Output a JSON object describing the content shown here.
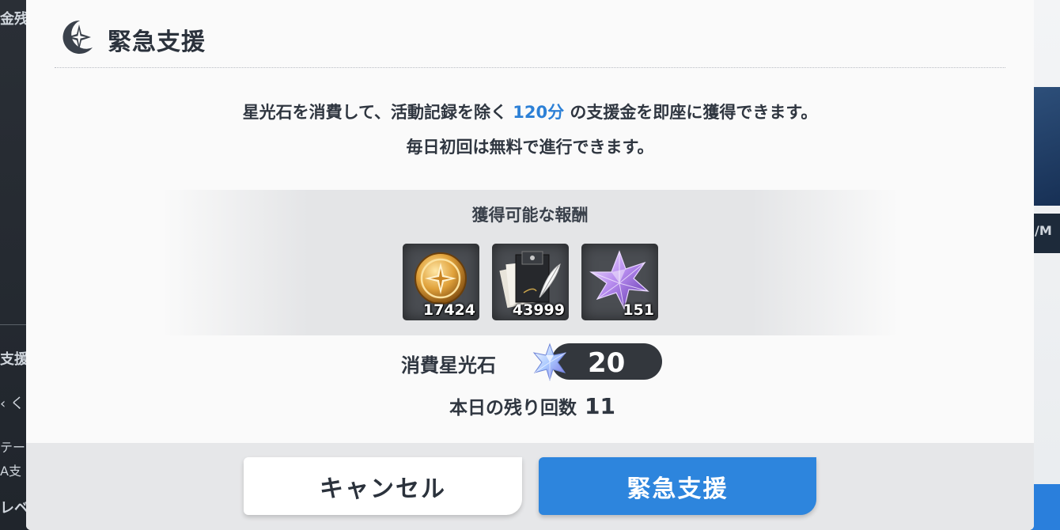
{
  "background": {
    "left_labels": [
      "金残",
      "支援",
      "‹ く",
      "テー",
      "A支",
      "レベ"
    ],
    "right_label": "/M"
  },
  "dialog": {
    "title": "緊急支援",
    "title_icon": "compass-star-icon",
    "description_line1_before": "星光石を消費して、活動記録を除く ",
    "description_line1_highlight": "120分",
    "description_line1_after": " の支援金を即座に獲得できます。",
    "description_line2": "毎日初回は無料で進行できます。",
    "highlight_color": "#2c80d6"
  },
  "rewards": {
    "title": "獲得可能な報酬",
    "items": [
      {
        "icon": "credit-coin-icon",
        "count": "17424"
      },
      {
        "icon": "activity-report-icon",
        "count": "43999"
      },
      {
        "icon": "pyroxene-crystal-icon",
        "count": "151"
      }
    ]
  },
  "cost": {
    "label": "消費星光石",
    "icon": "pyroxene-gem-icon",
    "value": "20"
  },
  "remaining": {
    "label": "本日の残り回数",
    "value": "11"
  },
  "buttons": {
    "cancel_label": "キャンセル",
    "confirm_label": "緊急支援",
    "confirm_color": "#2d85dd"
  }
}
